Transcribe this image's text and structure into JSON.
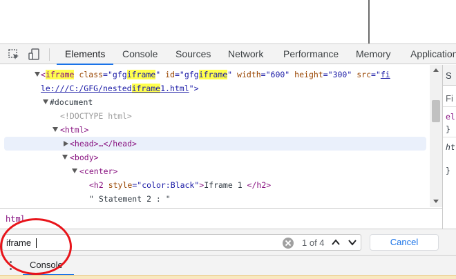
{
  "devtools": {
    "tabs": [
      {
        "label": "Elements"
      },
      {
        "label": "Console"
      },
      {
        "label": "Sources"
      },
      {
        "label": "Network"
      },
      {
        "label": "Performance"
      },
      {
        "label": "Memory"
      },
      {
        "label": "Application"
      }
    ],
    "active_tab": "Elements",
    "accent_color": "#1a73e8",
    "highlight_color": "#ffff4d",
    "annotation_color": "#e8141a"
  },
  "dom": {
    "line1": {
      "open": "<",
      "tag_hl": "iframe",
      "a1": "class",
      "eq": "=\"",
      "v1_pre": "gfg",
      "v1_hl": "iframe",
      "q": "\"",
      "a2": "id",
      "v2_pre": "gfg",
      "v2_hl": "iframe",
      "a3": "width",
      "v3": "600",
      "a4": "height",
      "v4": "300",
      "a5": "src",
      "v5_start": "fi"
    },
    "line2": {
      "pre": "le:///C:/GFG/nested",
      "hl": "iframe",
      "post": "1.html",
      "close": "\">"
    },
    "document": "#document",
    "doctype": "<!DOCTYPE html>",
    "html": "<html>",
    "head": "<head>…</head>",
    "body": "<body>",
    "center": "<center>",
    "h2_open": "<h2 ",
    "h2_attr": "style",
    "h2_val": "color:Black",
    "h2_text": "Iframe 1 ",
    "h2_close": "</h2>",
    "text_node": "\" Statement 2 : \""
  },
  "styles_pane": {
    "lines": [
      "S",
      "Fi",
      "el",
      "}",
      "ht",
      "}"
    ]
  },
  "breadcrumb": {
    "label": "html"
  },
  "search": {
    "value": "iframe",
    "match_count": "1 of 4",
    "cancel_label": "Cancel"
  },
  "drawer": {
    "tab_label": "Console"
  }
}
